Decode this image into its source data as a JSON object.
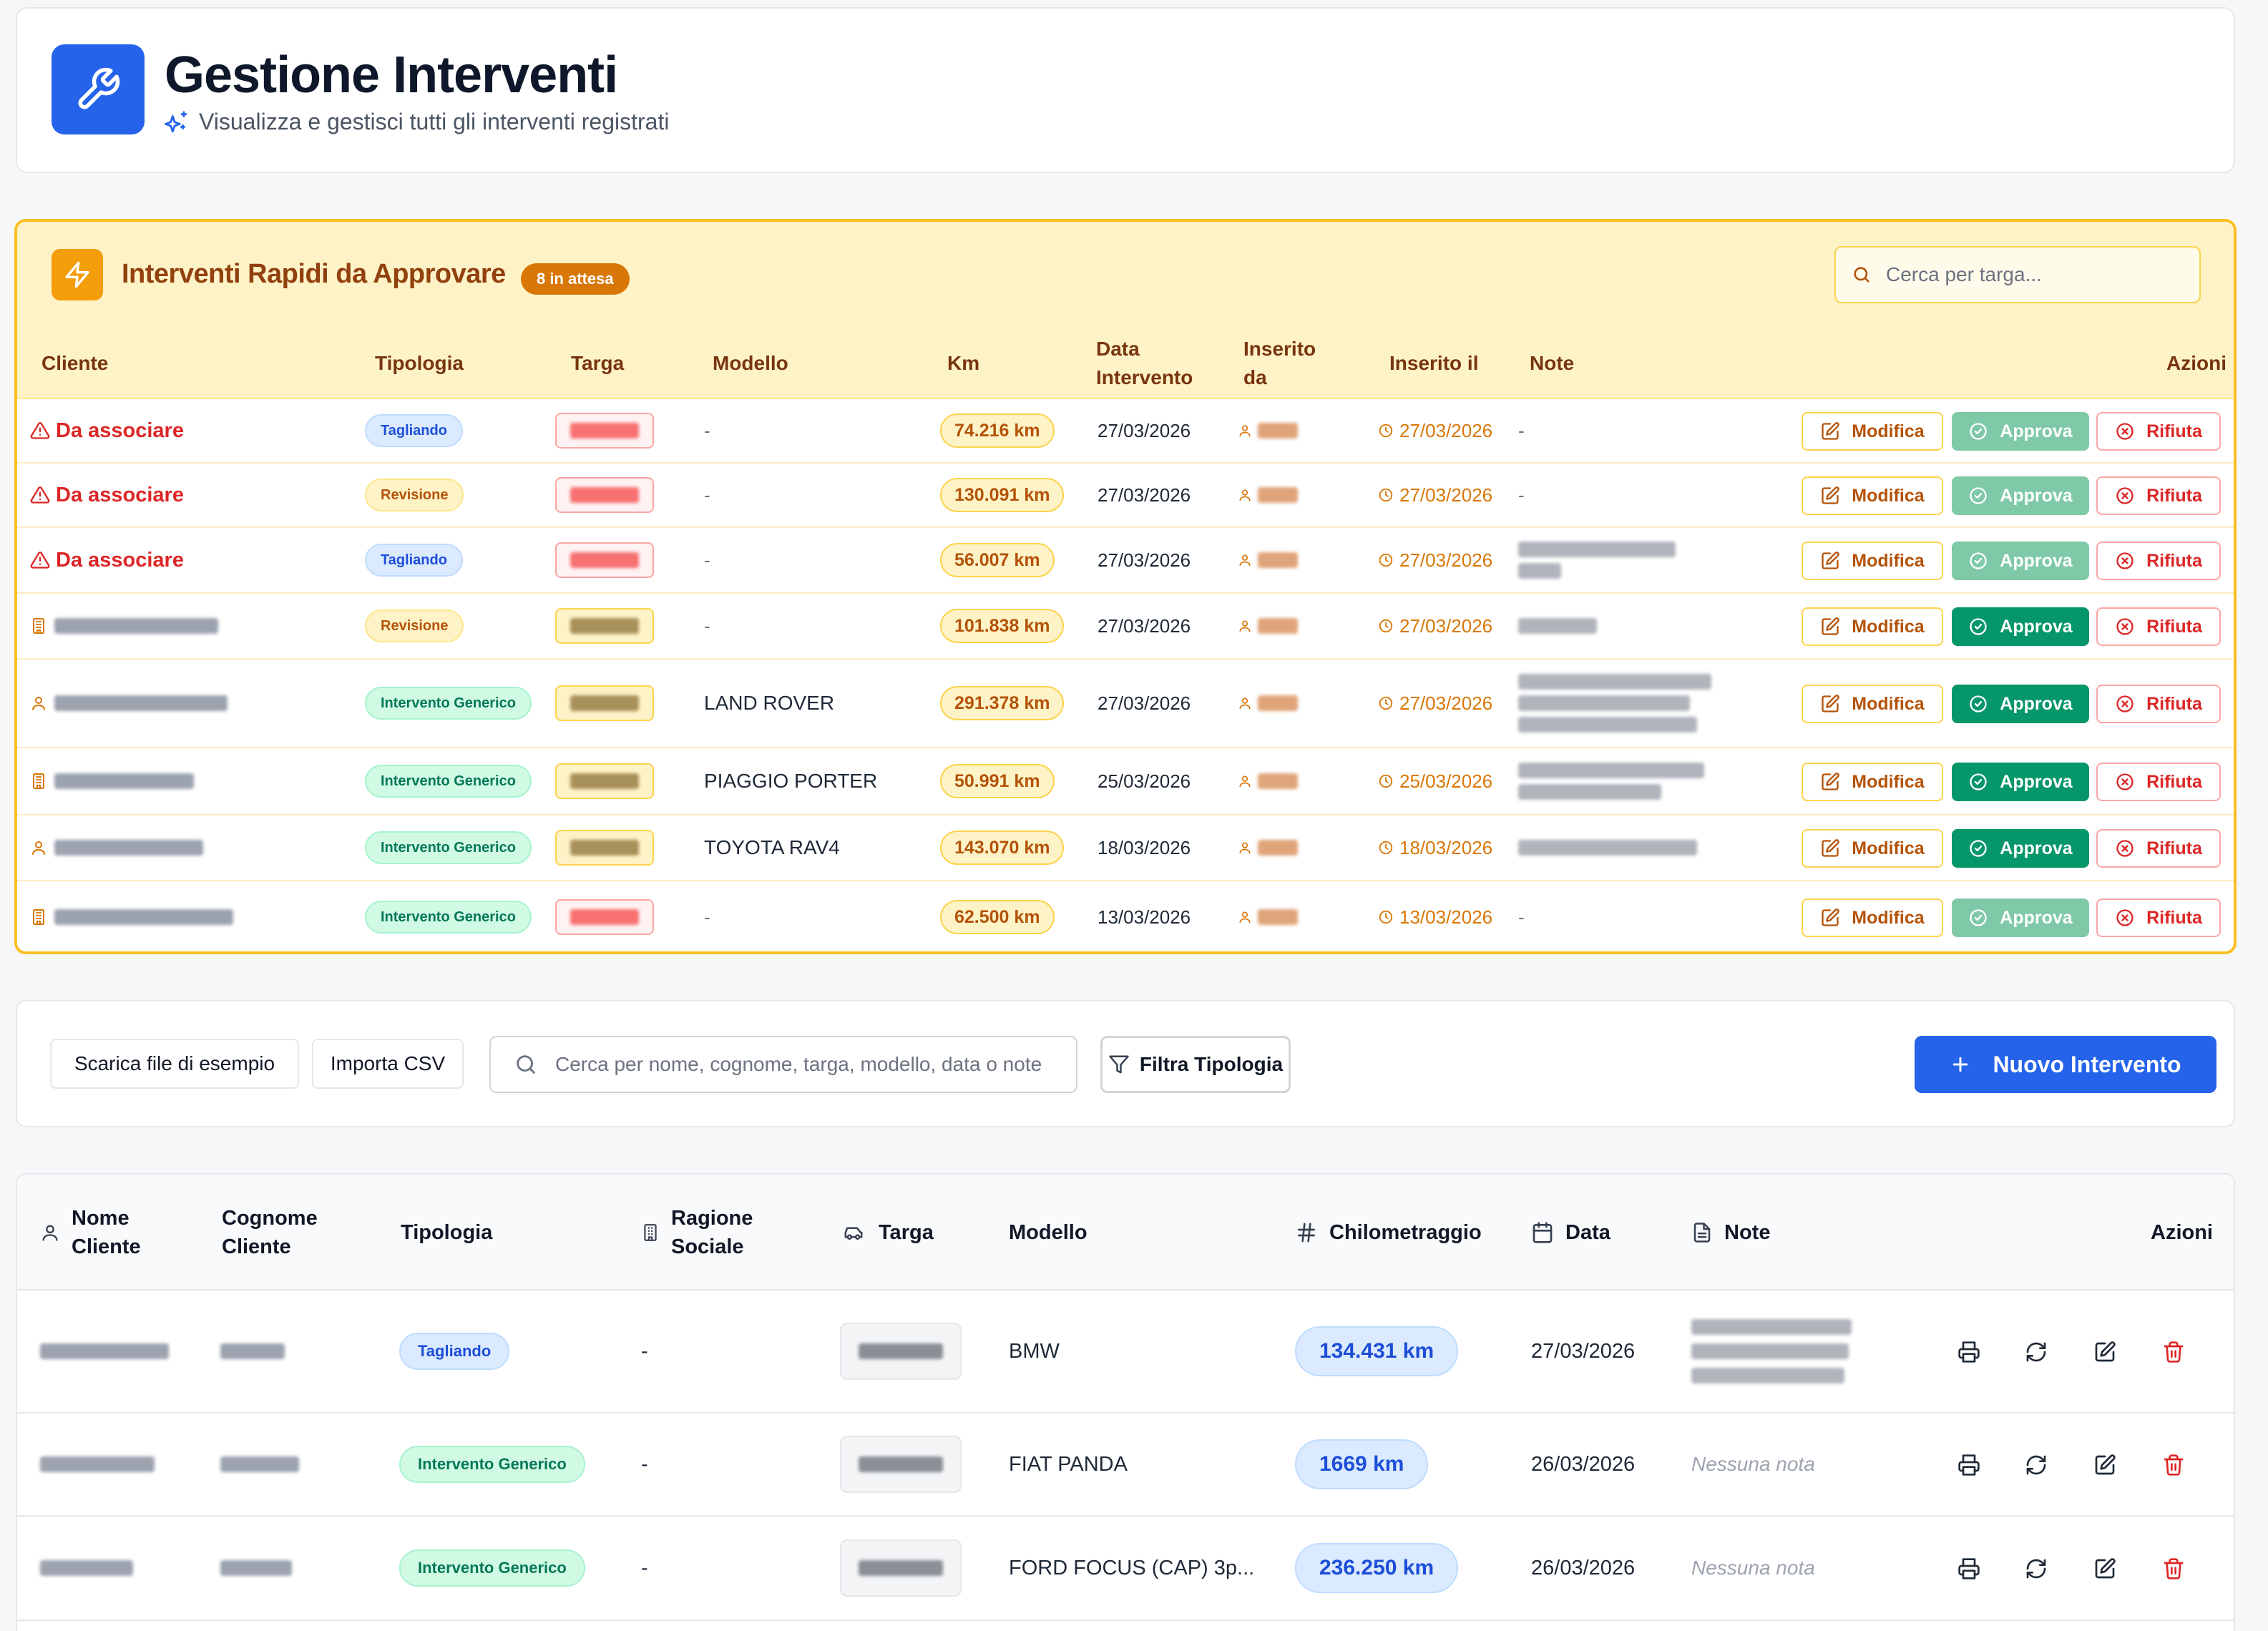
{
  "header": {
    "title": "Gestione Interventi",
    "subtitle": "Visualizza e gestisci tutti gli interventi registrati",
    "icon": "wrench-icon"
  },
  "quick": {
    "title": "Interventi Rapidi da Approvare",
    "badge": "8 in attesa",
    "search_placeholder": "Cerca per targa...",
    "columns": {
      "cliente": "Cliente",
      "tipologia": "Tipologia",
      "targa": "Targa",
      "modello": "Modello",
      "km": "Km",
      "data_line1": "Data",
      "data_line2": "Intervento",
      "inserito_da_line1": "Inserito",
      "inserito_da_line2": "da",
      "inserito_il": "Inserito il",
      "note": "Note",
      "azioni": "Azioni"
    },
    "buttons": {
      "modifica": "Modifica",
      "approva": "Approva",
      "rifiuta": "Rifiuta"
    },
    "rows": [
      {
        "cliente": "Da associare",
        "tipologia": "Tagliando",
        "modello": "-",
        "km": "74.216 km",
        "data": "27/03/2026",
        "inserito_il": "27/03/2026",
        "note": "-"
      },
      {
        "cliente": "Da associare",
        "tipologia": "Revisione",
        "modello": "-",
        "km": "130.091 km",
        "data": "27/03/2026",
        "inserito_il": "27/03/2026",
        "note": "-"
      },
      {
        "cliente": "Da associare",
        "tipologia": "Tagliando",
        "modello": "-",
        "km": "56.007 km",
        "data": "27/03/2026",
        "inserito_il": "27/03/2026",
        "note": ""
      },
      {
        "cliente": "",
        "tipologia": "Revisione",
        "modello": "-",
        "km": "101.838 km",
        "data": "27/03/2026",
        "inserito_il": "27/03/2026",
        "note": ""
      },
      {
        "cliente": "",
        "tipologia": "Intervento Generico",
        "modello": "LAND ROVER",
        "km": "291.378 km",
        "data": "27/03/2026",
        "inserito_il": "27/03/2026",
        "note": ""
      },
      {
        "cliente": "",
        "tipologia": "Intervento Generico",
        "modello": "PIAGGIO PORTER",
        "km": "50.991 km",
        "data": "25/03/2026",
        "inserito_il": "25/03/2026",
        "note": ""
      },
      {
        "cliente": "",
        "tipologia": "Intervento Generico",
        "modello": "TOYOTA RAV4",
        "km": "143.070 km",
        "data": "18/03/2026",
        "inserito_il": "18/03/2026",
        "note": ""
      },
      {
        "cliente": "",
        "tipologia": "Intervento Generico",
        "modello": "-",
        "km": "62.500 km",
        "data": "13/03/2026",
        "inserito_il": "13/03/2026",
        "note": "-"
      }
    ]
  },
  "toolbar": {
    "download_label": "Scarica file di esempio",
    "import_label": "Importa CSV",
    "search_placeholder": "Cerca per nome, cognome, targa, modello, data o note...",
    "filter_label": "Filtra Tipologia",
    "new_label": "Nuovo Intervento"
  },
  "main": {
    "columns": {
      "nome_line1": "Nome",
      "nome_line2": "Cliente",
      "cognome_line1": "Cognome",
      "cognome_line2": "Cliente",
      "tipologia": "Tipologia",
      "ragione_line1": "Ragione",
      "ragione_line2": "Sociale",
      "targa": "Targa",
      "modello": "Modello",
      "km": "Chilometraggio",
      "data": "Data",
      "note": "Note",
      "azioni": "Azioni"
    },
    "rows": [
      {
        "tipologia": "Tagliando",
        "ragione": "-",
        "modello": "BMW",
        "km": "134.431 km",
        "data": "27/03/2026",
        "note": ""
      },
      {
        "tipologia": "Intervento Generico",
        "ragione": "-",
        "modello": "FIAT PANDA",
        "km": "1669 km",
        "data": "26/03/2026",
        "note": "Nessuna nota"
      },
      {
        "tipologia": "Intervento Generico",
        "ragione": "-",
        "modello": "FORD FOCUS (CAP) 3p...",
        "km": "236.250 km",
        "data": "26/03/2026",
        "note": "Nessuna nota"
      }
    ]
  },
  "colors": {
    "primary": "#2563eb",
    "amber": "#f59e0b",
    "approve": "#059669",
    "reject": "#dc2626"
  }
}
